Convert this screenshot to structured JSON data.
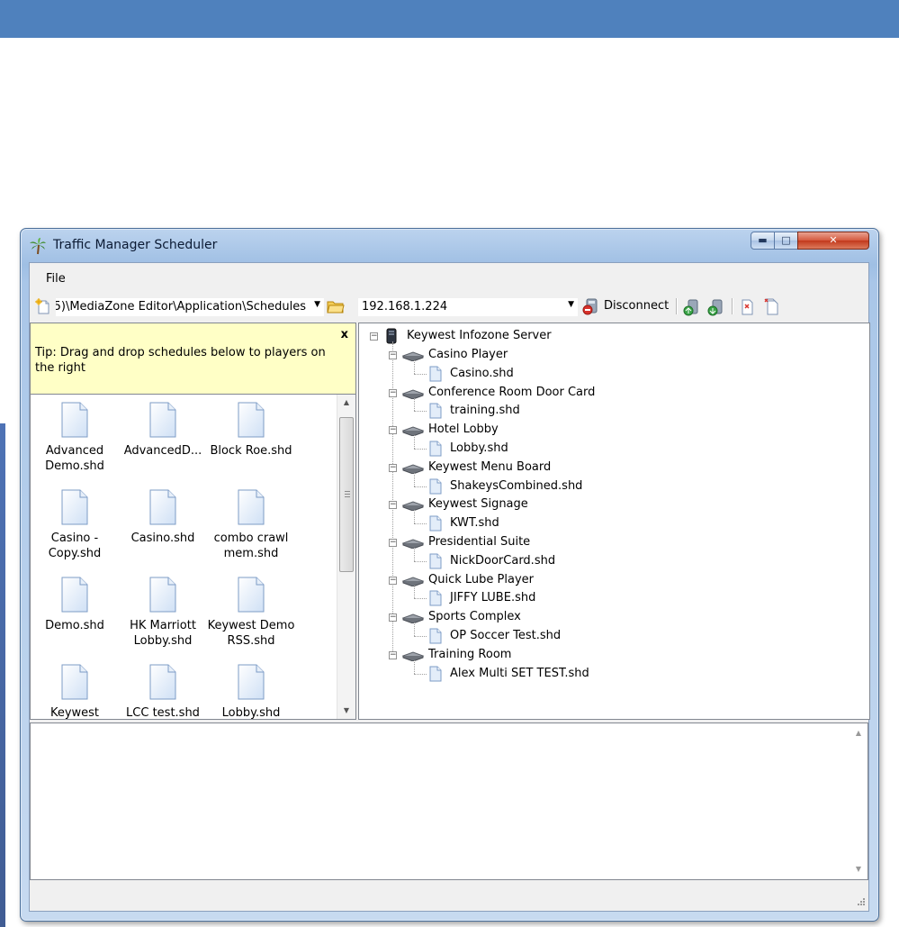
{
  "window": {
    "title": "Traffic Manager Scheduler"
  },
  "menu": {
    "file_label": "File"
  },
  "toolbar": {
    "schedules_path": "5)\\MediaZone Editor\\Application\\Schedules",
    "server_ip": "192.168.1.224",
    "disconnect_label": "Disconnect"
  },
  "tip": {
    "text": "Tip: Drag and drop schedules below to players on the right",
    "close_label": "x"
  },
  "files": [
    {
      "name": "Advanced Demo.shd"
    },
    {
      "name": "AdvancedD..."
    },
    {
      "name": "Block Roe.shd"
    },
    {
      "name": "Casino - Copy.shd"
    },
    {
      "name": "Casino.shd"
    },
    {
      "name": "combo crawl mem.shd"
    },
    {
      "name": "Demo.shd"
    },
    {
      "name": "HK Marriott Lobby.shd"
    },
    {
      "name": "Keywest Demo RSS.shd"
    },
    {
      "name": "Keywest"
    },
    {
      "name": "LCC test.shd"
    },
    {
      "name": "Lobby.shd"
    }
  ],
  "tree": {
    "root": "Keywest Infozone Server",
    "players": [
      {
        "name": "Casino Player",
        "schedule": "Casino.shd"
      },
      {
        "name": "Conference Room Door Card",
        "schedule": "training.shd"
      },
      {
        "name": "Hotel Lobby",
        "schedule": "Lobby.shd"
      },
      {
        "name": "Keywest Menu Board",
        "schedule": "ShakeysCombined.shd"
      },
      {
        "name": "Keywest Signage",
        "schedule": "KWT.shd"
      },
      {
        "name": "Presidential Suite",
        "schedule": "NickDoorCard.shd"
      },
      {
        "name": "Quick Lube Player",
        "schedule": "JIFFY LUBE.shd"
      },
      {
        "name": "Sports Complex",
        "schedule": "OP Soccer Test.shd"
      },
      {
        "name": "Training Room",
        "schedule": "Alex Multi SET TEST.shd"
      }
    ]
  },
  "icons": {
    "app": "palm-tree-icon",
    "new": "new-schedule-icon",
    "folder": "open-folder-icon",
    "disconnect": "disconnect-icon",
    "server": "server-icon",
    "player": "player-device-icon",
    "file": "schedule-file-icon"
  },
  "colors": {
    "banner": "#4f81bd",
    "tip_background": "#ffffc6",
    "window_frame": "#a9c6e8"
  }
}
